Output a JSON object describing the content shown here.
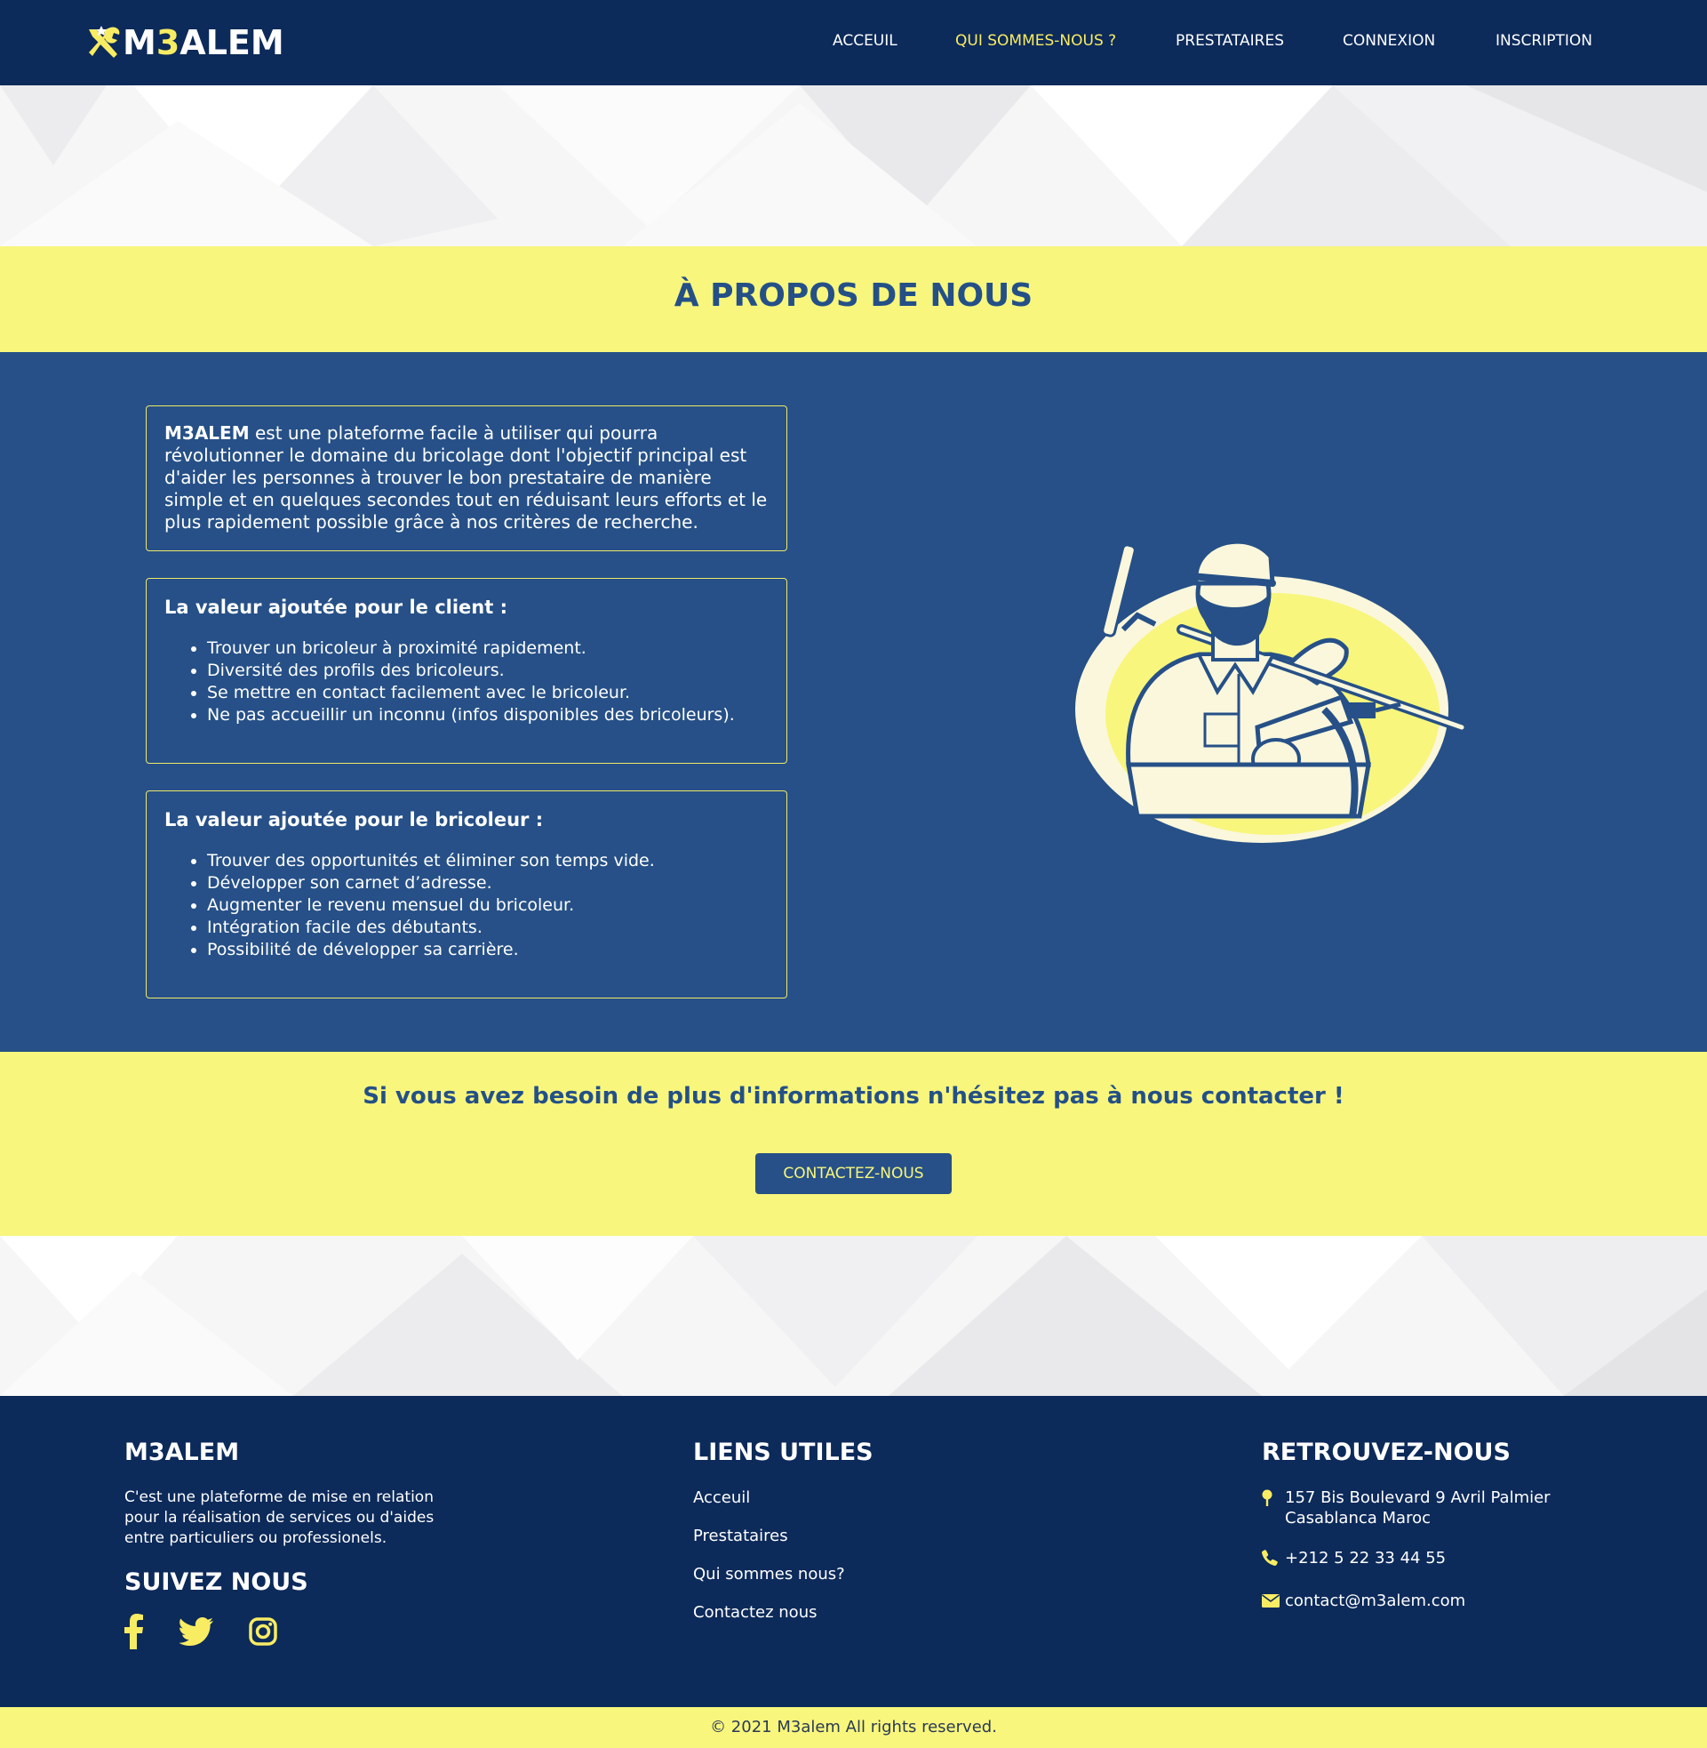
{
  "brand": {
    "logo_prefix": "M",
    "logo_highlight": "3",
    "logo_suffix": "ALEM"
  },
  "nav": {
    "items": [
      "ACCEUIL",
      "QUI SOMMES-NOUS ?",
      "PRESTATAIRES",
      "CONNEXION",
      "INSCRIPTION"
    ],
    "active": "QUI SOMMES-NOUS ?"
  },
  "about": {
    "title": "À PROPOS DE NOUS",
    "intro_brand": "M3ALEM",
    "intro_text": " est une plateforme facile à utiliser qui pourra révolutionner le domaine du bricolage dont l'objectif principal est d'aider les personnes à trouver le bon prestataire de manière simple et en quelques secondes tout en réduisant leurs efforts et le plus rapidement possible grâce à nos critères de recherche.",
    "client": {
      "heading": "La valeur ajoutée pour le client :",
      "items": [
        "Trouver un bricoleur à proximité rapidement.",
        "Diversité des profils des bricoleurs.",
        "Se mettre en contact facilement avec le bricoleur.",
        "Ne pas accueillir un inconnu (infos disponibles des bricoleurs)."
      ]
    },
    "bricoleur": {
      "heading": "La valeur ajoutée pour le bricoleur :",
      "items": [
        "Trouver des opportunités et éliminer son temps vide.",
        "Développer son carnet d’adresse.",
        "Augmenter le revenu mensuel du bricoleur.",
        "Intégration facile des débutants.",
        "Possibilité de développer sa carrière."
      ]
    }
  },
  "contact_band": {
    "text": "Si vous avez besoin de plus d'informations n'hésitez pas à nous contacter !",
    "button": "CONTACTEZ-NOUS"
  },
  "footer": {
    "brand_title": "M3ALEM",
    "description": "C'est une plateforme de mise en relation pour la réalisation de services ou d'aides entre particuliers ou professionels.",
    "follow_title": "SUIVEZ NOUS",
    "social_icons": [
      "facebook-icon",
      "twitter-icon",
      "instagram-icon"
    ],
    "links_title": "LIENS UTILES",
    "links": [
      "Acceuil",
      "Prestataires",
      "Qui sommes nous?",
      "Contactez nous"
    ],
    "find_title": "RETROUVEZ-NOUS",
    "address": "157 Bis Boulevard 9 Avril Palmier Casablanca Maroc",
    "phone": "+212 5 22 33 44 55",
    "email": "contact@m3alem.com"
  },
  "copyright": "© 2021 M3alem All rights reserved.",
  "colors": {
    "navy": "#0c2a5a",
    "blue": "#265087",
    "yellow": "#f8f67c",
    "accent": "#f8ec63"
  }
}
